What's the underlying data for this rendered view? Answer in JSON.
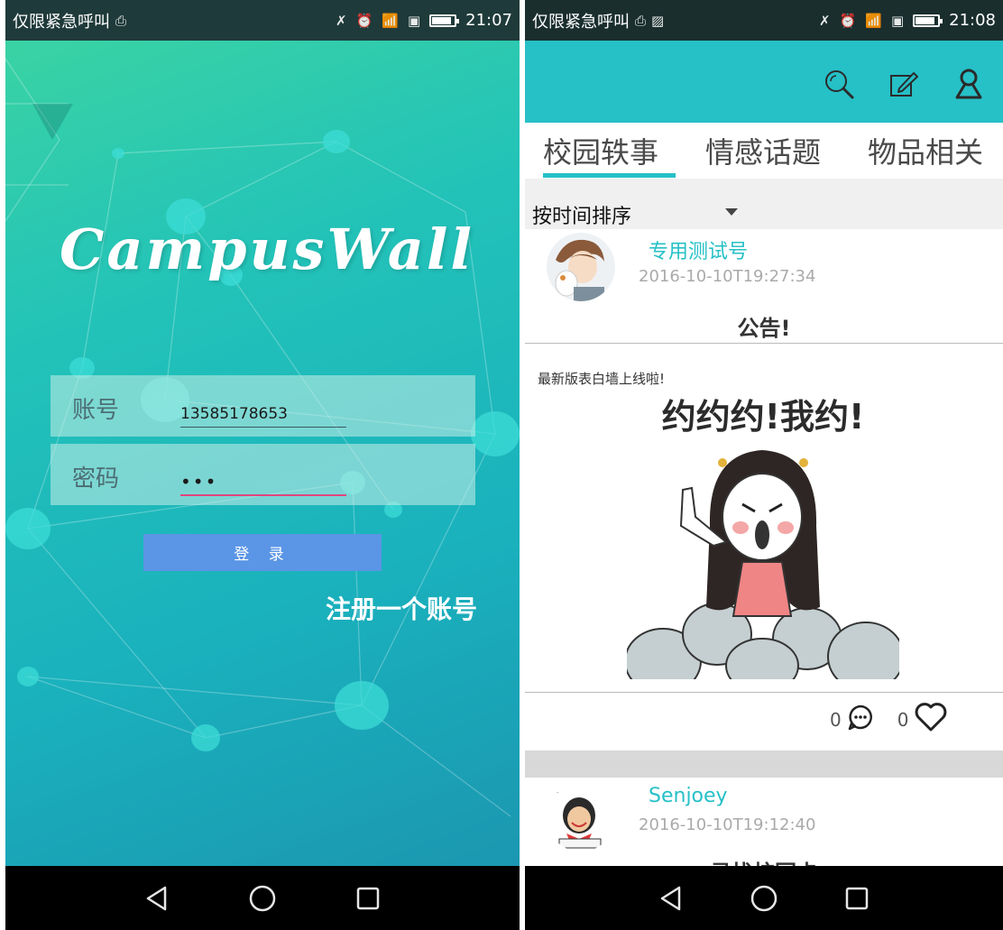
{
  "login_screen": {
    "status_bar": {
      "carrier": "仅限紧急呼叫",
      "time": "21:07"
    },
    "logo": "CampusWall",
    "account": {
      "label": "账号",
      "value": "13585178653"
    },
    "password": {
      "label": "密码",
      "value": "•••"
    },
    "login_button": "登 录",
    "register_link": "注册一个账号"
  },
  "feed_screen": {
    "status_bar": {
      "carrier": "仅限紧急呼叫",
      "time": "21:08"
    },
    "accent_color": "#26c0c7",
    "toolbar_icons": [
      "search-icon",
      "edit-icon",
      "user-icon"
    ],
    "tabs": [
      {
        "label": "校园轶事",
        "active": true
      },
      {
        "label": "情感话题",
        "active": false
      },
      {
        "label": "物品相关",
        "active": false
      }
    ],
    "sort": {
      "label": "按时间排序"
    },
    "posts": [
      {
        "username": "专用测试号",
        "timestamp": "2016-10-10T19:27:34",
        "title": "公告!",
        "body": "最新版表白墙上线啦!",
        "image_text": "约约约!我约!",
        "comment_count": "0",
        "like_count": "0"
      },
      {
        "username": "Senjoey",
        "timestamp": "2016-10-10T19:12:40",
        "title": "寻找校园卡"
      }
    ]
  }
}
